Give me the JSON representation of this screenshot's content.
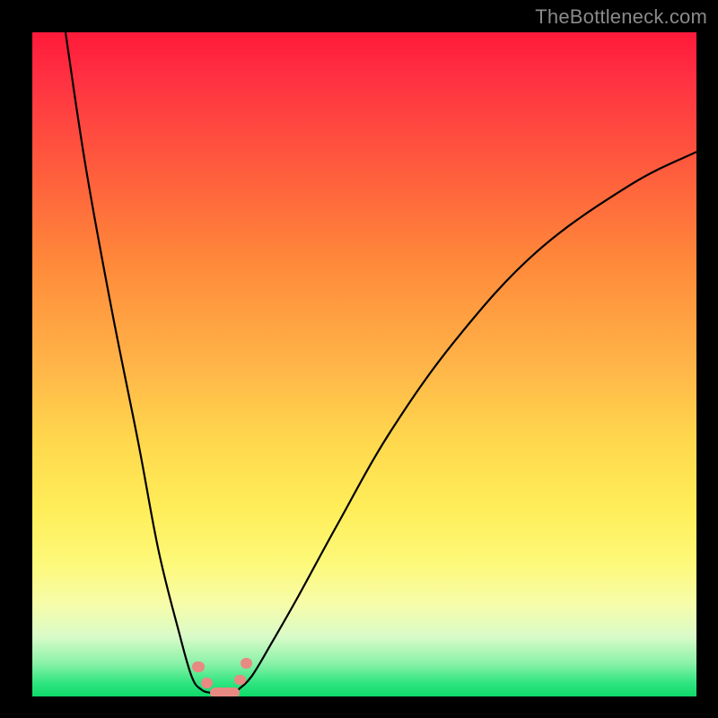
{
  "watermark": "TheBottleneck.com",
  "colors": {
    "frame": "#000000",
    "curve": "#000000",
    "marker": "#e88a82"
  },
  "chart_data": {
    "type": "line",
    "title": "",
    "xlabel": "",
    "ylabel": "",
    "xlim": [
      0,
      100
    ],
    "ylim": [
      0,
      100
    ],
    "grid": false,
    "legend": false,
    "note": "No axes, ticks, or data labels are shown. Values below are estimated from pixel positions; y=0 is bottom (green), y=100 is top (red).",
    "series": [
      {
        "name": "left-curve",
        "x": [
          5,
          8,
          12,
          16,
          19,
          22,
          24,
          25.5,
          27,
          28
        ],
        "y": [
          100,
          80,
          58,
          38,
          22,
          10,
          3,
          1,
          0.5,
          0
        ]
      },
      {
        "name": "right-curve",
        "x": [
          30,
          31,
          33,
          36,
          40,
          46,
          54,
          64,
          76,
          90,
          100
        ],
        "y": [
          0,
          1,
          3,
          8,
          15,
          26,
          40,
          54,
          67,
          77,
          82
        ]
      }
    ],
    "markers": [
      {
        "name": "left-upper",
        "x": 25.0,
        "y": 4.5
      },
      {
        "name": "left-lower",
        "x": 26.3,
        "y": 2.0
      },
      {
        "name": "right-upper",
        "x": 32.2,
        "y": 5.0
      },
      {
        "name": "right-lower",
        "x": 31.3,
        "y": 2.5
      },
      {
        "name": "bottom-bar",
        "x": 29.0,
        "y": 0.5,
        "w": 4.5
      }
    ],
    "gradient_stops": [
      {
        "pos": 0,
        "color": "#ff1a3a"
      },
      {
        "pos": 50,
        "color": "#ffb448"
      },
      {
        "pos": 80,
        "color": "#fdf97a"
      },
      {
        "pos": 100,
        "color": "#0fd96a"
      }
    ]
  }
}
